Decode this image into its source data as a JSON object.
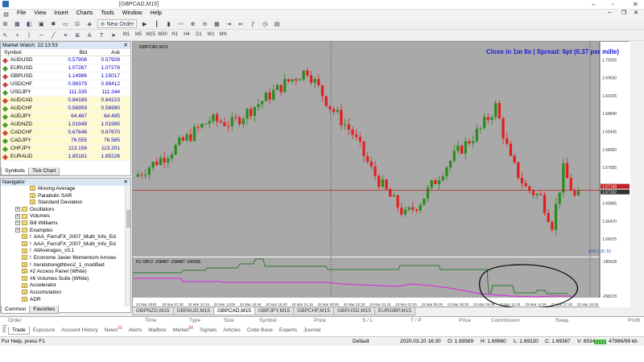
{
  "window": {
    "title": "[GBPCAD,M15]"
  },
  "menu": [
    "File",
    "View",
    "Insert",
    "Charts",
    "Tools",
    "Window",
    "Help"
  ],
  "toolbar": {
    "new_order": "New Order",
    "timeframes": [
      "M1",
      "M5",
      "M15",
      "M30",
      "H1",
      "H4",
      "D1",
      "W1",
      "MN"
    ]
  },
  "market_watch": {
    "header": "Market Watch: 22:13:53",
    "col_symbol": "Symbol",
    "col_bid": "Bid",
    "col_ask": "Ask",
    "rows": [
      {
        "symbol": "AUDUSD",
        "bid": "0.57908",
        "ask": "0.57928",
        "dot": "#d04040"
      },
      {
        "symbol": "EURUSD",
        "bid": "1.07267",
        "ask": "1.07278",
        "dot": "#4a9a30"
      },
      {
        "symbol": "GBPUSD",
        "bid": "1.14986",
        "ask": "1.15017",
        "dot": "#d04040"
      },
      {
        "symbol": "USDCHF",
        "bid": "0.98379",
        "ask": "0.98412",
        "dot": "#d04040"
      },
      {
        "symbol": "USDJPY",
        "bid": "111.335",
        "ask": "111.344",
        "dot": "#4a9a30"
      },
      {
        "symbol": "AUDCAD",
        "bid": "0.84189",
        "ask": "0.84223",
        "dot": "#d04040"
      },
      {
        "symbol": "AUDCHF",
        "bid": "0.56959",
        "ask": "0.56990",
        "dot": "#4a9a30"
      },
      {
        "symbol": "AUDJPY",
        "bid": "64.467",
        "ask": "64.495",
        "dot": "#4a9a30"
      },
      {
        "symbol": "AUDNZD",
        "bid": "1.01949",
        "ask": "1.01995",
        "dot": "#4a9a30"
      },
      {
        "symbol": "CADCHF",
        "bid": "0.67646",
        "ask": "0.67670",
        "dot": "#d04040"
      },
      {
        "symbol": "CADJPY",
        "bid": "76.555",
        "ask": "76.585",
        "dot": "#4a9a30"
      },
      {
        "symbol": "CHFJPY",
        "bid": "113.156",
        "ask": "113.201",
        "dot": "#4a9a30"
      },
      {
        "symbol": "EURAUD",
        "bid": "1.85181",
        "ask": "1.85226",
        "dot": "#d04040"
      }
    ],
    "tabs": [
      "Symbols",
      "Tick Chart"
    ]
  },
  "navigator": {
    "header": "Navigator",
    "items": [
      {
        "label": "Moving Average",
        "indent": 36
      },
      {
        "label": "Parabolic SAR",
        "indent": 36
      },
      {
        "label": "Standard Deviation",
        "indent": 36
      },
      {
        "label": "Oscillators",
        "indent": 18
      },
      {
        "label": "Volumes",
        "indent": 18
      },
      {
        "label": "Bill Williams",
        "indent": 18
      },
      {
        "label": "Examples",
        "indent": 18
      },
      {
        "label": "AAA_FerruFX_2007_Multi_Info_Ed",
        "indent": 26,
        "prefix": "!"
      },
      {
        "label": "AAA_FerruFX_2007_Multi_Info_Ed",
        "indent": 26,
        "prefix": "!"
      },
      {
        "label": "AllAverages_v3.1",
        "indent": 26,
        "prefix": "!"
      },
      {
        "label": "Econome Javier Momentum Arrows",
        "indent": 26,
        "prefix": "!"
      },
      {
        "label": "trendstrengthbvo2_1_modified",
        "indent": 26,
        "prefix": "!"
      },
      {
        "label": "#2 Access Panel (White)",
        "indent": 26
      },
      {
        "label": "#6 Volumes Suite (White)",
        "indent": 26
      },
      {
        "label": "Accelerator",
        "indent": 26
      },
      {
        "label": "Accumulation",
        "indent": 26
      },
      {
        "label": "ADR",
        "indent": 26
      }
    ],
    "tabs": [
      "Common",
      "Favorites"
    ]
  },
  "chart": {
    "symbol_label": "GBPCAD,M15",
    "spread_text": "Close in 1m 8s | Spread: 6pt (0.37 per mille)",
    "atr_label": "ATR (10): 51",
    "indicator_label": "H1 OBV2 -258487 -258487 -245556",
    "price_axis": [
      "1.70025",
      "1.69630",
      "1.69235",
      "1.68840",
      "1.68445",
      "1.68050",
      "1.67655",
      "1.67260",
      "1.66865",
      "1.66470",
      "1.66075"
    ],
    "price_highlight_1": "1.67148",
    "price_highlight_2": "1.67162",
    "ind_axis": [
      "-185636",
      "-258215"
    ],
    "time_axis": [
      "20 Mar 2020",
      "20 Mar 07:30",
      "20 Mar 10:15",
      "20 Mar 13:00",
      "20 Mar 15:45",
      "20 Mar 18:30",
      "20 Mar 21:15",
      "20 Mar 00:00",
      "20 Mar 22:30",
      "23 Mar 01:15",
      "23 Mar 02:30",
      "23 Mar 05:30",
      "23 Mar 08:30",
      "23 Mar 09:45",
      "23 Mar 11:30",
      "23 Mar 14:30",
      "23 Mar 17:30",
      "23 Mar 20:30"
    ],
    "bull_color": "#2e8b1e",
    "bear_color": "#e02020",
    "bg_color": "#a9a9a9"
  },
  "chart_tabs": [
    {
      "label": "GBPNZD,M15",
      "active": false
    },
    {
      "label": "GBPAUD,M15",
      "active": false
    },
    {
      "label": "GBPCAD,M15",
      "active": true
    },
    {
      "label": "GBPJPY,M15",
      "active": false
    },
    {
      "label": "GBPCHF,M15",
      "active": false
    },
    {
      "label": "GBPUSD,M15",
      "active": false
    },
    {
      "label": "EURGBP,M15",
      "active": false
    }
  ],
  "terminal": {
    "side_label": "Tml",
    "columns": [
      "Order",
      "Time",
      "Type",
      "Size",
      "Symbol",
      "Price",
      "S / L",
      "T / P",
      "Price",
      "Commission",
      "Swap",
      "Profit"
    ],
    "tabs": [
      {
        "label": "Trade",
        "badge": ""
      },
      {
        "label": "Exposure",
        "badge": ""
      },
      {
        "label": "Account History",
        "badge": ""
      },
      {
        "label": "News",
        "badge": "33"
      },
      {
        "label": "Alerts",
        "badge": ""
      },
      {
        "label": "Mailbox",
        "badge": ""
      },
      {
        "label": "Market",
        "badge": "68"
      },
      {
        "label": "Signals",
        "badge": ""
      },
      {
        "label": "Articles",
        "badge": ""
      },
      {
        "label": "Code Base",
        "badge": ""
      },
      {
        "label": "Experts",
        "badge": ""
      },
      {
        "label": "Journal",
        "badge": ""
      }
    ]
  },
  "status_bar": {
    "help": "For Help, press F1",
    "profile": "Default",
    "datetime": "2020.03.20 16:30",
    "open": "O: 1.69569",
    "high": "H: 1.69960",
    "low": "L: 1.69220",
    "close": "C: 1.69367",
    "volume": "V: 6534",
    "traffic": "47986/99 kb"
  }
}
